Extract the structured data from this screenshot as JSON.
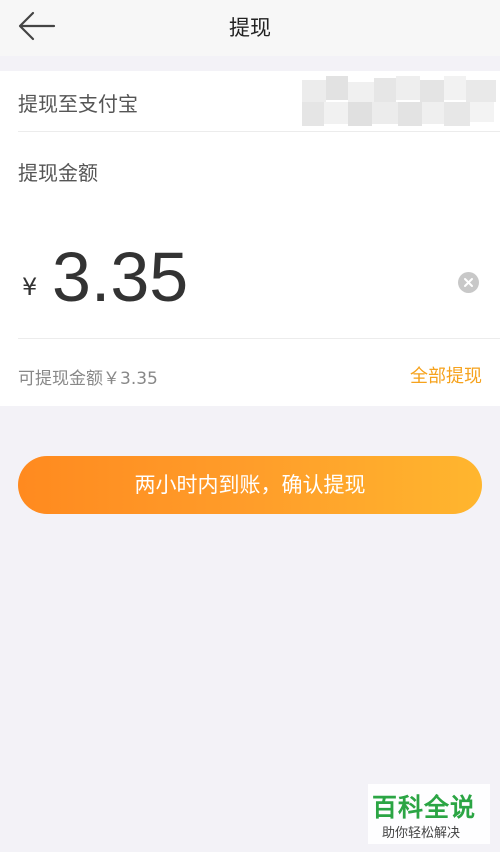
{
  "header": {
    "title": "提现",
    "back_icon": "back-arrow-icon"
  },
  "account": {
    "label": "提现至支付宝",
    "value_state": "masked"
  },
  "amount": {
    "label": "提现金额",
    "currency_symbol": "¥",
    "value": "3.35",
    "clear_icon": "clear-icon"
  },
  "available": {
    "text": "可提现金额￥3.35",
    "withdraw_all_label": "全部提现"
  },
  "confirm_button": {
    "label": "两小时内到账，确认提现"
  },
  "watermark": {
    "title": "百科全说",
    "subtitle": "助你轻松解决"
  },
  "colors": {
    "accent": "#f6a21c",
    "button_start": "#ff8a1f",
    "button_end": "#ffb62e",
    "background": "#f3f2f7",
    "watermark": "#2ba544"
  }
}
